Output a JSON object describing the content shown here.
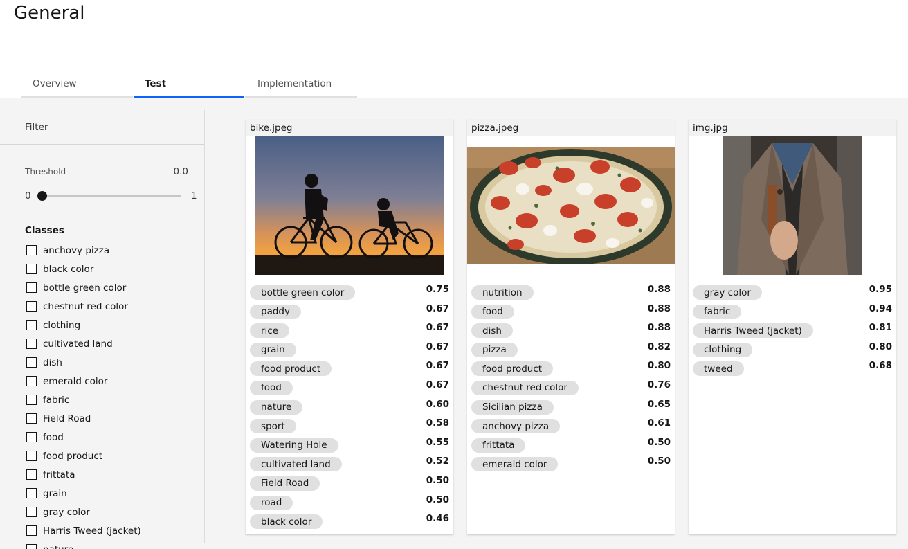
{
  "page": {
    "title": "General"
  },
  "tabs": [
    {
      "label": "Overview"
    },
    {
      "label": "Test"
    },
    {
      "label": "Implementation"
    }
  ],
  "sidebar": {
    "filter_label": "Filter",
    "threshold": {
      "label": "Threshold",
      "value": "0.0",
      "min": "0",
      "max": "1"
    },
    "classes_title": "Classes",
    "classes": [
      "anchovy pizza",
      "black color",
      "bottle green color",
      "chestnut red color",
      "clothing",
      "cultivated land",
      "dish",
      "emerald color",
      "fabric",
      "Field Road",
      "food",
      "food product",
      "frittata",
      "grain",
      "gray color",
      "Harris Tweed (jacket)",
      "nature"
    ]
  },
  "results": [
    {
      "filename": "bike.jpeg",
      "image": "bike-silhouette-sunset",
      "tags": [
        {
          "label": "bottle green color",
          "score": "0.75"
        },
        {
          "label": "paddy",
          "score": "0.67"
        },
        {
          "label": "rice",
          "score": "0.67"
        },
        {
          "label": "grain",
          "score": "0.67"
        },
        {
          "label": "food product",
          "score": "0.67"
        },
        {
          "label": "food",
          "score": "0.67"
        },
        {
          "label": "nature",
          "score": "0.60"
        },
        {
          "label": "sport",
          "score": "0.58"
        },
        {
          "label": "Watering Hole",
          "score": "0.55"
        },
        {
          "label": "cultivated land",
          "score": "0.52"
        },
        {
          "label": "Field Road",
          "score": "0.50"
        },
        {
          "label": "road",
          "score": "0.50"
        },
        {
          "label": "black color",
          "score": "0.46"
        }
      ]
    },
    {
      "filename": "pizza.jpeg",
      "image": "pizza-photo",
      "tags": [
        {
          "label": "nutrition",
          "score": "0.88"
        },
        {
          "label": "food",
          "score": "0.88"
        },
        {
          "label": "dish",
          "score": "0.88"
        },
        {
          "label": "pizza",
          "score": "0.82"
        },
        {
          "label": "food product",
          "score": "0.80"
        },
        {
          "label": "chestnut red color",
          "score": "0.76"
        },
        {
          "label": "Sicilian pizza",
          "score": "0.65"
        },
        {
          "label": "anchovy pizza",
          "score": "0.61"
        },
        {
          "label": "frittata",
          "score": "0.50"
        },
        {
          "label": "emerald color",
          "score": "0.50"
        }
      ]
    },
    {
      "filename": "img.jpg",
      "image": "man-in-tweed-jacket",
      "tags": [
        {
          "label": "gray color",
          "score": "0.95"
        },
        {
          "label": "fabric",
          "score": "0.94"
        },
        {
          "label": "Harris Tweed (jacket)",
          "score": "0.81"
        },
        {
          "label": "clothing",
          "score": "0.80"
        },
        {
          "label": "tweed",
          "score": "0.68"
        }
      ]
    }
  ],
  "colors": {
    "accent": "#0f62fe",
    "tag_bg": "#e0e0e0",
    "workspace_bg": "#f4f4f4"
  }
}
